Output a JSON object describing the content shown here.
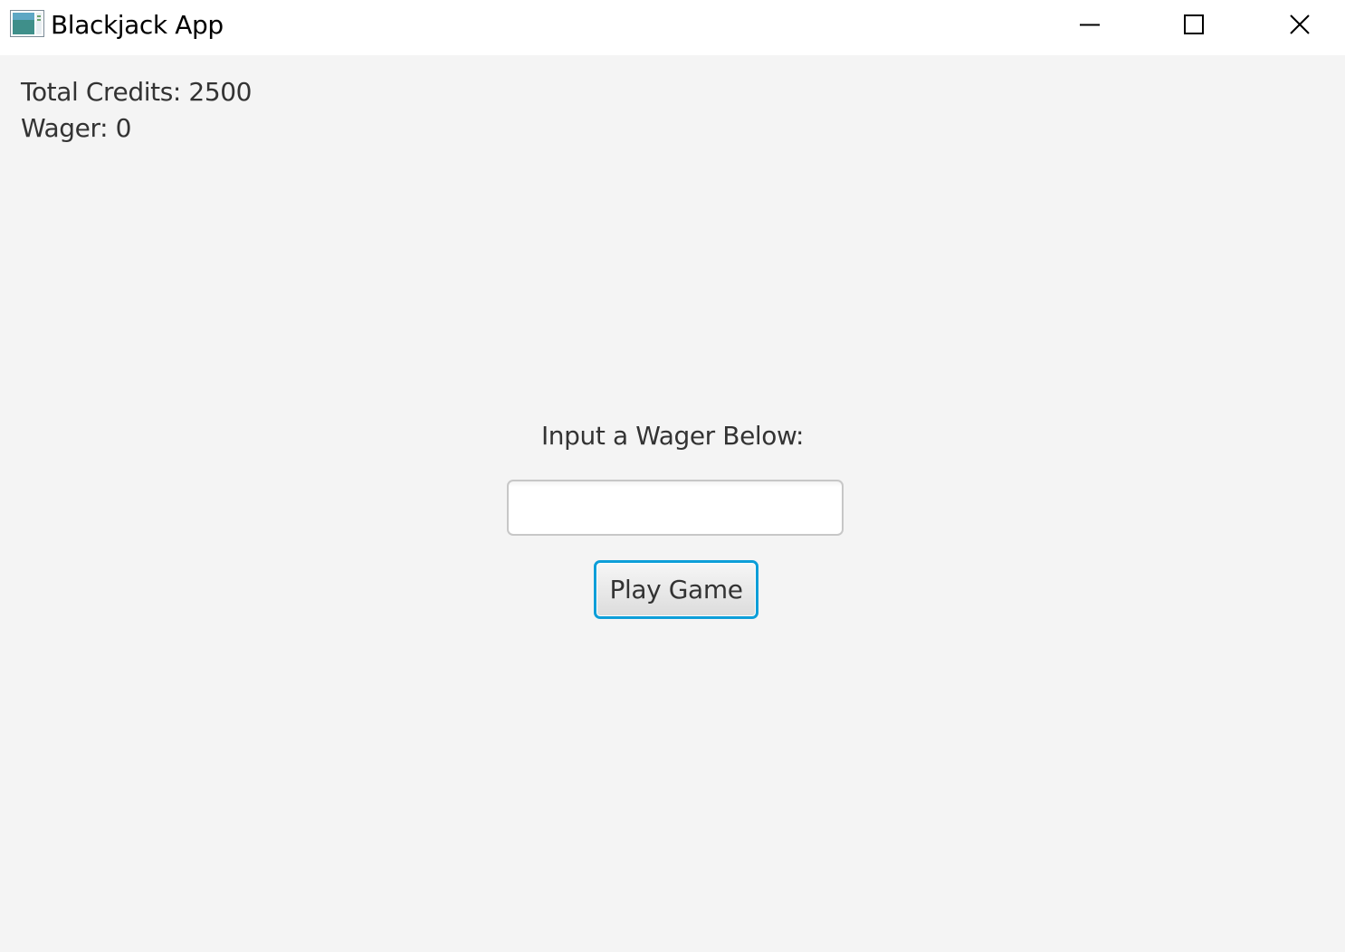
{
  "window": {
    "title": "Blackjack App",
    "icon": "java-app-icon",
    "controls": [
      "minimize-icon",
      "maximize-icon",
      "close-icon"
    ]
  },
  "status": {
    "credits_text": "Total Credits: 2500",
    "wager_text": "Wager: 0"
  },
  "form": {
    "prompt": "Input a Wager Below:",
    "wager_value": "",
    "wager_placeholder": "",
    "play_button_label": "Play Game"
  },
  "colors": {
    "background": "#f4f4f4",
    "titlebar": "#ffffff",
    "focus_border": "#0d9ed8",
    "text": "#333333"
  }
}
